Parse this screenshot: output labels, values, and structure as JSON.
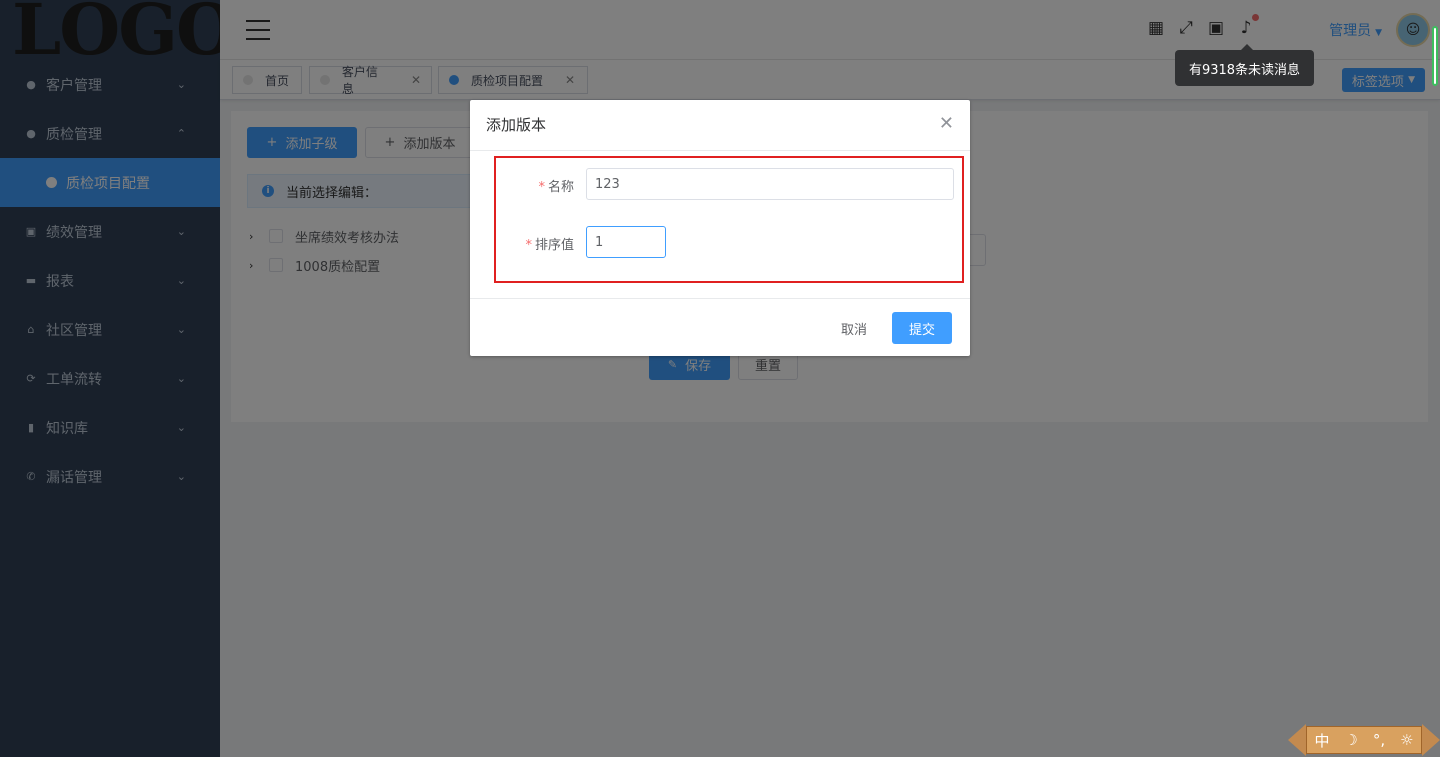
{
  "logo": {
    "text": "LOGO"
  },
  "sidebar": {
    "items": [
      {
        "label": "客户管理",
        "icon": "customer-icon",
        "expanded": false
      },
      {
        "label": "质检管理",
        "icon": "quality-icon",
        "expanded": true
      },
      {
        "label": "质检项目配置",
        "icon": "dot-icon",
        "sub": true,
        "active": true
      },
      {
        "label": "绩效管理",
        "icon": "performance-icon",
        "expanded": false
      },
      {
        "label": "报表",
        "icon": "report-icon",
        "expanded": false
      },
      {
        "label": "社区管理",
        "icon": "home-icon",
        "expanded": false
      },
      {
        "label": "工单流转",
        "icon": "refresh-icon",
        "expanded": false
      },
      {
        "label": "知识库",
        "icon": "book-icon",
        "expanded": false
      },
      {
        "label": "漏话管理",
        "icon": "phone-icon",
        "expanded": false
      }
    ]
  },
  "navbar": {
    "user": "管理员",
    "tooltip": "有9318条未读消息",
    "icons": [
      "grid-icon",
      "fullscreen-icon",
      "lock-icon",
      "bell-icon"
    ]
  },
  "tabs": [
    {
      "label": "首页",
      "active": false,
      "closable": false
    },
    {
      "label": "客户信息",
      "active": false,
      "closable": true
    },
    {
      "label": "质检项目配置",
      "active": true,
      "closable": true
    }
  ],
  "tag_options": "标签选项",
  "content": {
    "add_child": "添加子级",
    "add_version": "添加版本",
    "alert": "当前选择编辑：",
    "tree": [
      "坐席绩效考核办法",
      "1008质检配置"
    ],
    "save": "保存",
    "reset": "重置"
  },
  "dialog": {
    "title": "添加版本",
    "fields": [
      {
        "label": "名称",
        "value": "123",
        "required": true
      },
      {
        "label": "排序值",
        "value": "1",
        "required": true
      }
    ],
    "cancel": "取消",
    "submit": "提交"
  },
  "ime": {
    "items": [
      "中",
      "☽",
      "°,",
      "☼"
    ]
  },
  "colors": {
    "primary": "#409eff",
    "sidebar": "#304156",
    "highlight": "#e02020"
  }
}
